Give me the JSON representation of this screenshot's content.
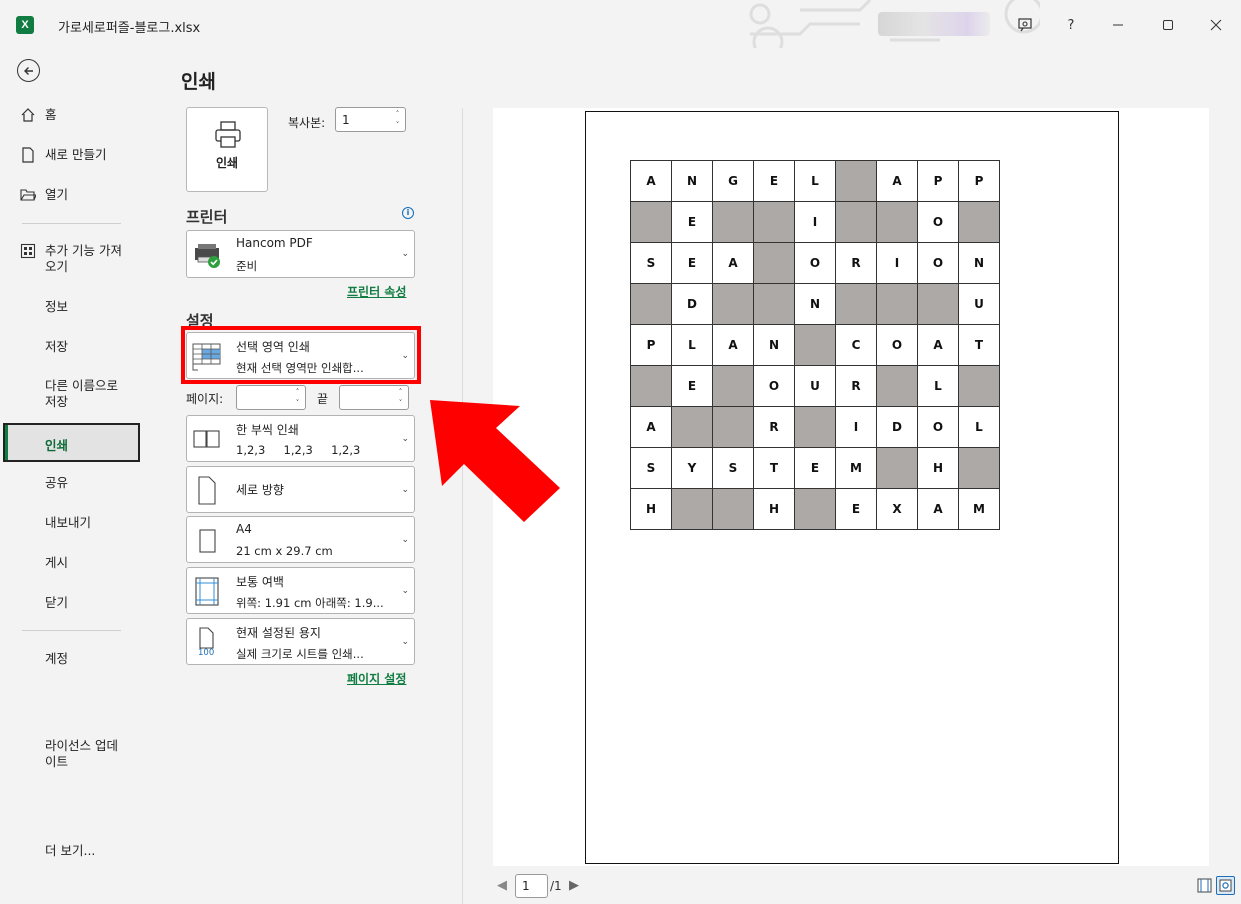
{
  "window": {
    "title": "가로세로퍼즐-블로그.xlsx",
    "app_icon": "excel-icon",
    "help_label": "?"
  },
  "nav": {
    "items": [
      {
        "label": "홈",
        "icon": "home-icon"
      },
      {
        "label": "새로 만들기",
        "icon": "new-doc-icon"
      },
      {
        "label": "열기",
        "icon": "folder-open-icon"
      },
      {
        "label": "추가 기능 가져오기",
        "icon": "addins-icon"
      },
      {
        "label": "정보"
      },
      {
        "label": "저장"
      },
      {
        "label": "다른 이름으로 저장"
      },
      {
        "label": "인쇄"
      },
      {
        "label": "공유"
      },
      {
        "label": "내보내기"
      },
      {
        "label": "게시"
      },
      {
        "label": "닫기"
      },
      {
        "label": "계정"
      },
      {
        "label": "라이선스 업데이트"
      },
      {
        "label": "더 보기..."
      }
    ],
    "active": "인쇄"
  },
  "print": {
    "title": "인쇄",
    "print_button": "인쇄",
    "copies_label": "복사본:",
    "copies_value": "1",
    "printer_heading": "프린터",
    "printer_name": "Hancom PDF",
    "printer_status": "준비",
    "printer_props_link": "프린터 속성",
    "settings_heading": "설정",
    "what_to_print": {
      "line1": "선택 영역 인쇄",
      "line2": "현재 선택 영역만 인쇄합..."
    },
    "pages_label": "페이지:",
    "end_label": "끝",
    "collate": {
      "line1": "한 부씩 인쇄",
      "line2": "1,2,3     1,2,3     1,2,3"
    },
    "orientation": {
      "line1": "세로 방향"
    },
    "paper_size": {
      "line1": "A4",
      "line2": "21 cm x 29.7 cm"
    },
    "margins": {
      "line1": "보통 여백",
      "line2": "위쪽: 1.91 cm 아래쪽: 1.9..."
    },
    "scaling": {
      "line1": "현재 설정된 용지",
      "line2": "실제 크기로 시트를 인쇄...",
      "icon_text": "100"
    },
    "page_setup_link": "페이지 설정"
  },
  "preview": {
    "current_page": "1",
    "total_pages": "/1",
    "grid": [
      [
        "A",
        "N",
        "G",
        "E",
        "L",
        "#",
        "A",
        "P",
        "P"
      ],
      [
        "#",
        "E",
        "#",
        "#",
        "I",
        "#",
        "#",
        "O",
        "#"
      ],
      [
        "S",
        "E",
        "A",
        "#",
        "O",
        "R",
        "I",
        "O",
        "N"
      ],
      [
        "#",
        "D",
        "#",
        "#",
        "N",
        "#",
        "#",
        "#",
        "U"
      ],
      [
        "P",
        "L",
        "A",
        "N",
        "#",
        "C",
        "O",
        "A",
        "T"
      ],
      [
        "#",
        "E",
        "#",
        "O",
        "U",
        "R",
        "#",
        "L",
        "#"
      ],
      [
        "A",
        "#",
        "#",
        "R",
        "#",
        "I",
        "D",
        "O",
        "L"
      ],
      [
        "S",
        "Y",
        "S",
        "T",
        "E",
        "M",
        "#",
        "H",
        "#"
      ],
      [
        "H",
        "#",
        "#",
        "H",
        "#",
        "E",
        "X",
        "A",
        "M"
      ]
    ]
  },
  "colors": {
    "accent": "#107c41",
    "highlight": "#ff0000",
    "blocked_cell": "#aca9a7"
  }
}
